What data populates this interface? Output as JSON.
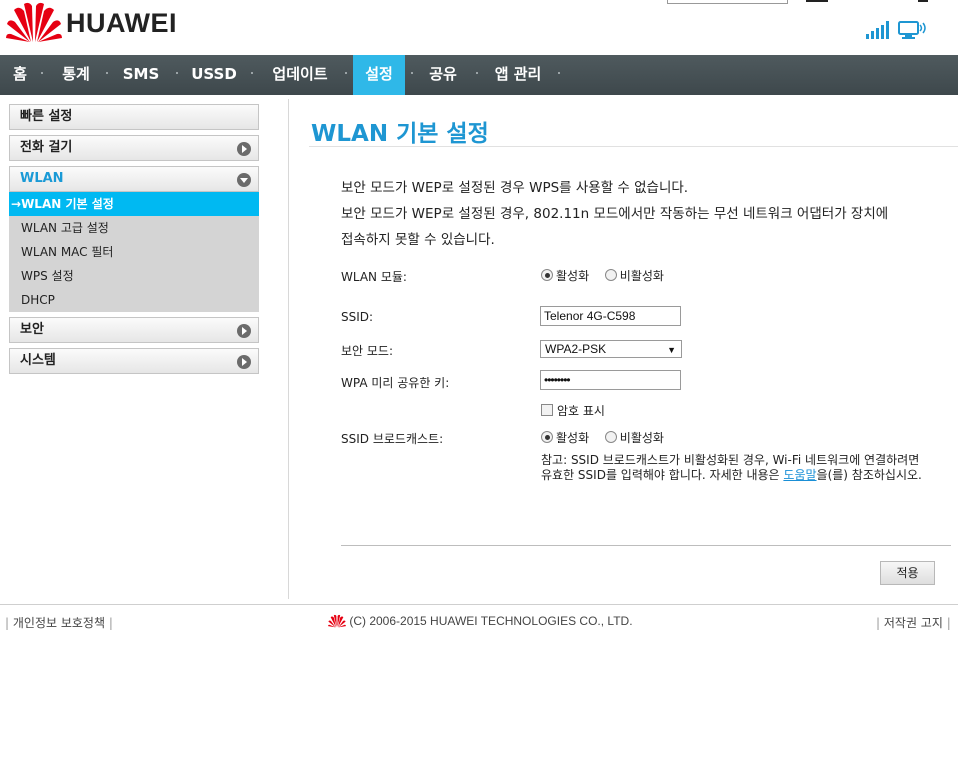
{
  "header": {
    "brand": "HUAWEI",
    "signal_icon": "signal-strength-icon",
    "connection_icon": "monitor-connection-icon",
    "colors": {
      "logo_red": "#e60012",
      "nav_bg": "#464f53",
      "nav_active": "#2fb8e8",
      "accent": "#1e96d2"
    }
  },
  "nav": {
    "items": [
      "홈",
      "통계",
      "SMS",
      "USSD",
      "업데이트",
      "설정",
      "공유",
      "앱 관리"
    ],
    "active": "설정"
  },
  "sidebar": {
    "quick_setup": "빠른 설정",
    "dial": "전화 걸기",
    "wlan": "WLAN",
    "wlan_items": [
      "WLAN 기본 설정",
      "WLAN 고급 설정",
      "WLAN MAC 필터",
      "WPS 설정",
      "DHCP"
    ],
    "active_item_prefix": "→",
    "security": "보안",
    "system": "시스템"
  },
  "main": {
    "title": "WLAN 기본 설정",
    "notes": [
      "보안 모드가 WEP로 설정된 경우 WPS를 사용할 수 없습니다.",
      "보안 모드가 WEP로 설정된 경우, 802.11n 모드에서만 작동하는 무선 네트워크 어댑터가 장치에",
      "접속하지 못할 수 있습니다."
    ],
    "wlan_module_label": "WLAN 모듈:",
    "enable_label": "활성화",
    "disable_label": "비활성화",
    "wlan_module_value": "활성화",
    "ssid_label": "SSID:",
    "ssid_value": "Telenor 4G-C598",
    "security_mode_label": "보안 모드:",
    "security_mode_value": "WPA2-PSK",
    "wpa_key_label": "WPA 미리 공유한 키:",
    "wpa_key_value": "••••••••",
    "show_password_label": "암호 표시",
    "ssid_broadcast_label": "SSID 브로드캐스트:",
    "ssid_broadcast_value": "활성화",
    "ssid_note_part1": "참고: SSID 브로드캐스트가 비활성화된 경우, Wi-Fi 네트워크에 연결하려면 유효한 SSID를 입력해야 합니다. 자세한 내용은 ",
    "ssid_note_link": "도움말",
    "ssid_note_part2": "을(를) 참조하십시오.",
    "apply_label": "적용"
  },
  "footer": {
    "privacy": "개인정보 보호정책",
    "copyright": "(C) 2006-2015 HUAWEI TECHNOLOGIES CO., LTD.",
    "copyright_notice": "저작권 고지"
  }
}
